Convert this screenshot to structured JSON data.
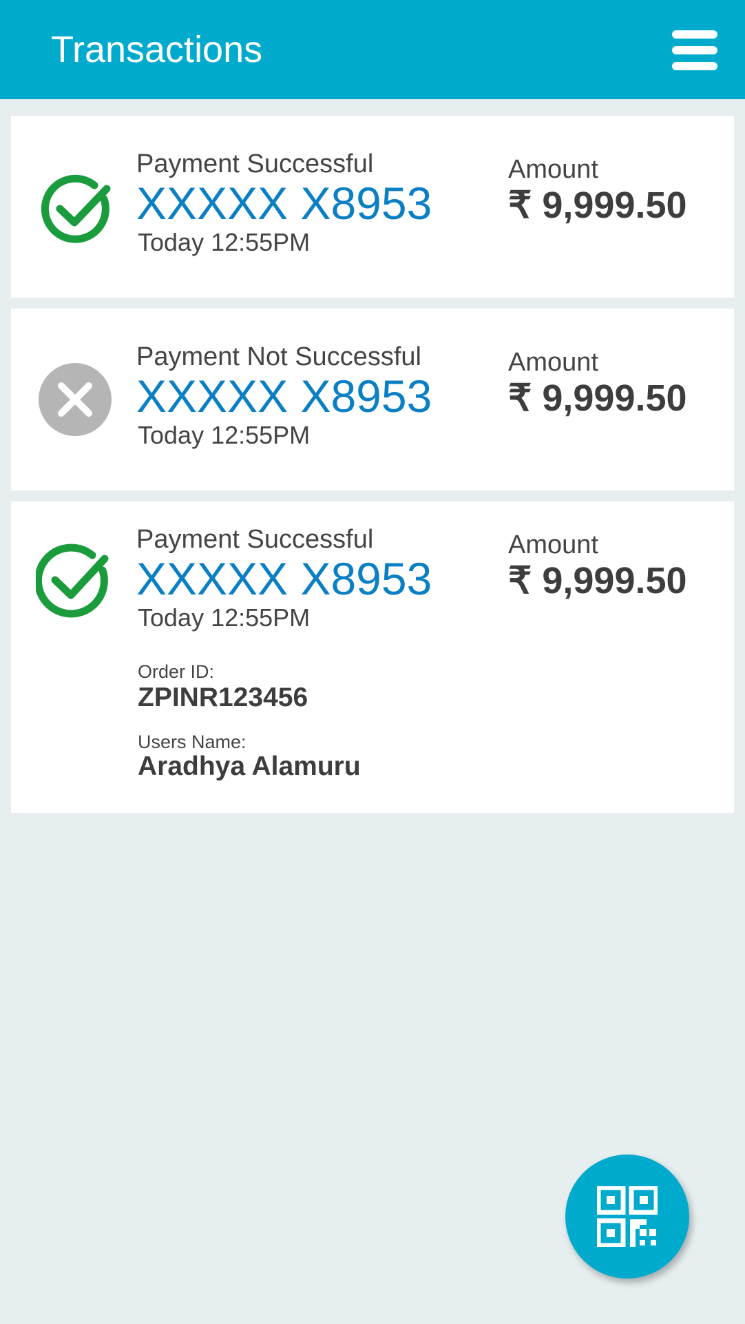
{
  "header": {
    "title": "Transactions",
    "menu_icon": "hamburger-menu-icon"
  },
  "transactions": [
    {
      "status": "Payment Successful",
      "status_icon": "check-circle-icon",
      "masked_number": "XXXXX X8953",
      "time": "Today 12:55PM",
      "amount_label": "Amount",
      "amount": "₹ 9,999.50"
    },
    {
      "status": "Payment Not Successful",
      "status_icon": "close-circle-icon",
      "masked_number": "XXXXX X8953",
      "time": "Today 12:55PM",
      "amount_label": "Amount",
      "amount": "₹ 9,999.50"
    },
    {
      "status": "Payment Successful",
      "status_icon": "check-circle-icon",
      "masked_number": "XXXXX X8953",
      "time": "Today 12:55PM",
      "amount_label": "Amount",
      "amount": "₹ 9,999.50",
      "order_id_label": "Order ID:",
      "order_id": "ZPINR123456",
      "user_name_label": "Users Name:",
      "user_name": "Aradhya Alamuru"
    }
  ],
  "fab": {
    "icon": "qr-code-icon"
  },
  "colors": {
    "header": "#00aacd",
    "background": "#e6eef0",
    "success": "#1a9b3c",
    "failure": "#b5b5b5",
    "masked_number": "#0a7fc4",
    "text": "#3d3d3d"
  }
}
